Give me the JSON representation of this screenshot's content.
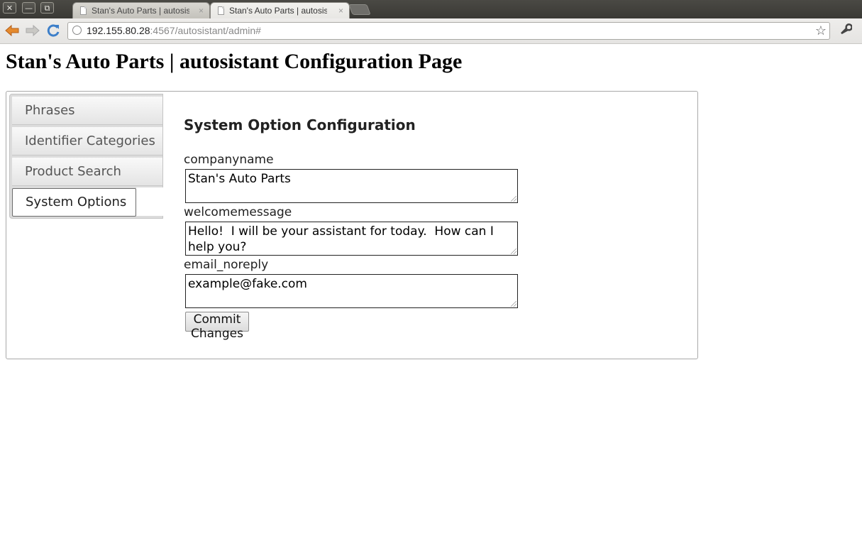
{
  "browser": {
    "window_buttons": [
      "✕",
      "—",
      "⧉"
    ],
    "tabs": [
      {
        "title": "Stan's Auto Parts | autosis",
        "close": "×"
      },
      {
        "title": "Stan's Auto Parts | autosis",
        "close": "×"
      }
    ],
    "address": {
      "host": "192.155.80.28",
      "rest": ":4567/autosistant/admin#"
    },
    "colors": {
      "titlebar": "#3f3e3a",
      "back_arrow": "#e0751e",
      "reload": "#3d7fc9"
    },
    "icons": {
      "back": "back-arrow-icon",
      "forward": "forward-arrow-icon",
      "reload": "reload-icon",
      "star": "star-icon",
      "wrench": "wrench-icon"
    }
  },
  "page": {
    "title": "Stan's Auto Parts | autosistant Configuration Page"
  },
  "sidebar": {
    "items": [
      {
        "label": "Phrases"
      },
      {
        "label": "Identifier Categories"
      },
      {
        "label": "Product Search"
      },
      {
        "label": "System Options"
      }
    ],
    "selected": "System Options"
  },
  "main": {
    "heading": "System Option Configuration",
    "fields": [
      {
        "label": "companyname",
        "value": "Stan's Auto Parts"
      },
      {
        "label": "welcomemessage",
        "value": "Hello!  I will be your assistant for today.  How can I help you?"
      },
      {
        "label": "email_noreply",
        "value": "example@fake.com"
      }
    ],
    "submit_label": "Commit Changes"
  }
}
